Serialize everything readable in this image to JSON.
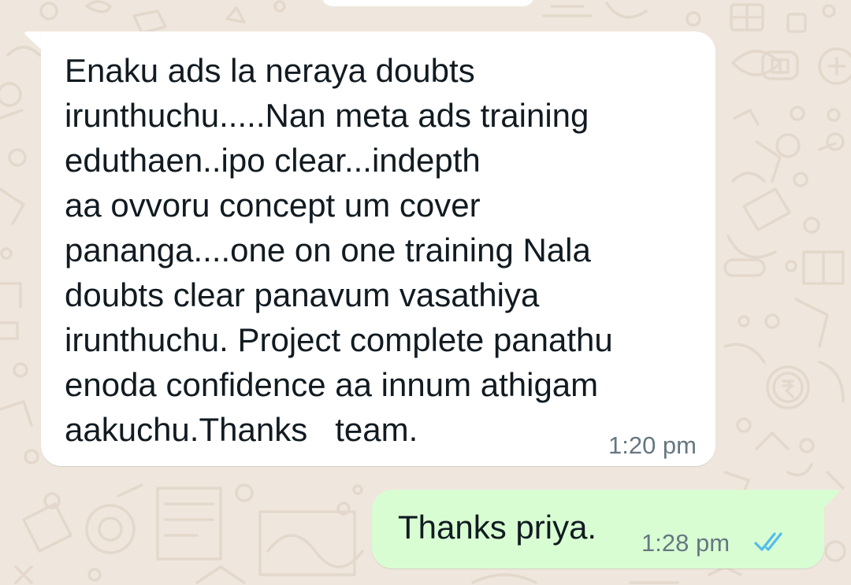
{
  "chat": {
    "incoming": {
      "text": "Enaku ads la neraya doubts\nirunthuchu.....Nan meta ads training\neduthaen..ipo clear...indepth\naa ovvoru concept um cover\npananga....one on one training Nala\ndoubts clear panavum vasathiya\nirunthuchu. Project complete panathu\nenoda confidence aa innum athigam\naakuchu.Thanks   team.",
      "time": "1:20 pm"
    },
    "outgoing": {
      "text": "Thanks priya.",
      "time": "1:28 pm",
      "status_icon": "double-check-read-icon"
    }
  },
  "colors": {
    "wallpaper": "#efe7dd",
    "wallpaper_doodle": "#e3d8cb",
    "incoming_bubble": "#ffffff",
    "outgoing_bubble": "#d9fdd3",
    "read_ticks": "#53bdeb",
    "timestamp": "#667781",
    "text": "#111b21"
  }
}
